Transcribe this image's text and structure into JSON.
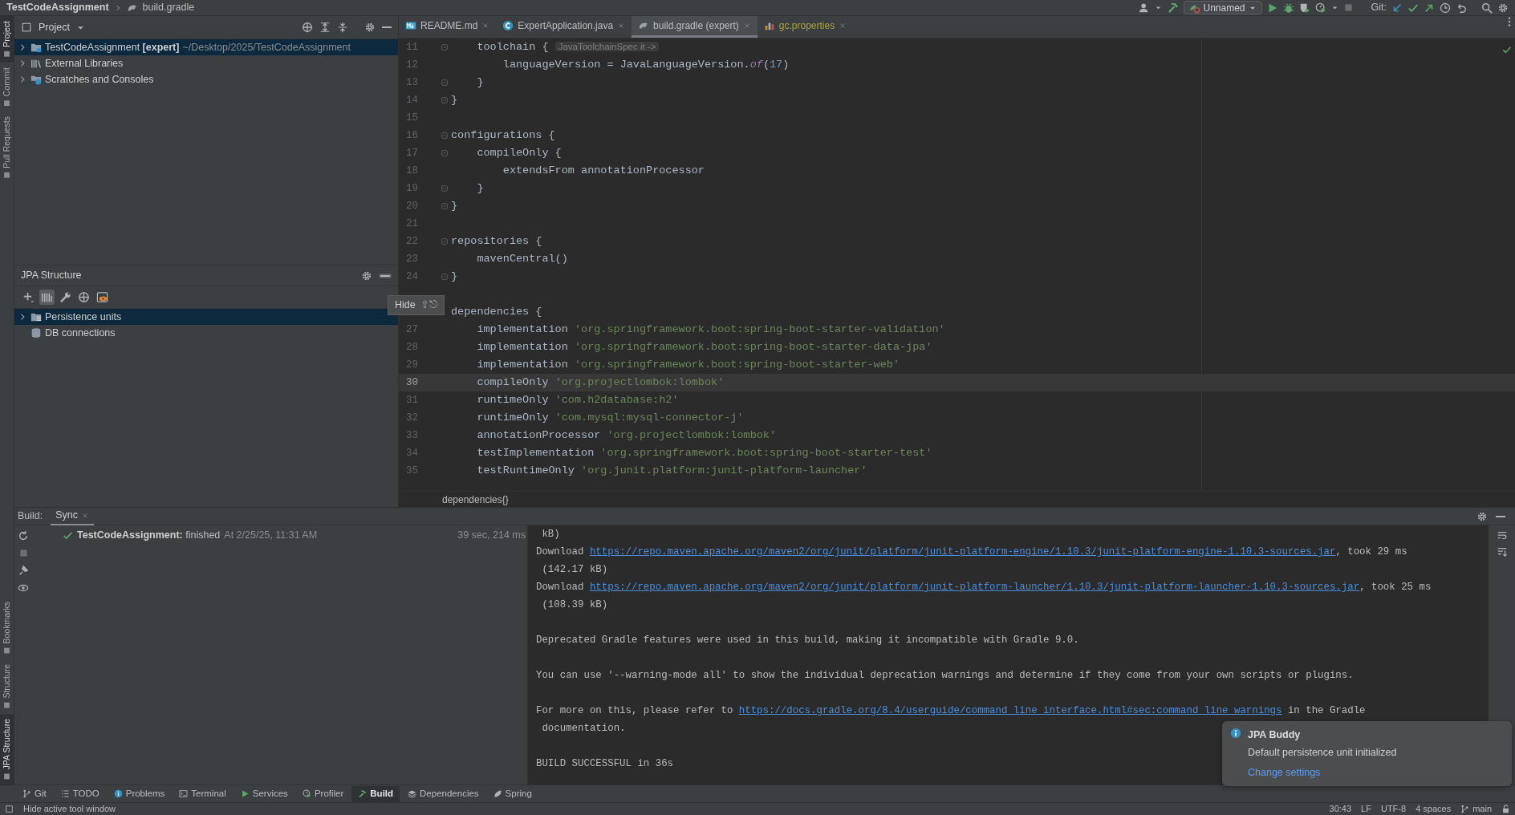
{
  "title_bar": {
    "project": "TestCodeAssignment",
    "file": "build.gradle",
    "run_config": "Unnamed",
    "git_label": "Git:"
  },
  "left_stripe": [
    {
      "label": "Project",
      "selected": true,
      "kind": "top"
    },
    {
      "label": "Commit",
      "selected": false,
      "kind": "top"
    },
    {
      "label": "Pull Requests",
      "selected": false,
      "kind": "top"
    },
    {
      "label": "Bookmarks",
      "selected": false,
      "kind": "bottom"
    },
    {
      "label": "Structure",
      "selected": false,
      "kind": "bottom"
    },
    {
      "label": "JPA Structure",
      "selected": true,
      "kind": "bottom"
    }
  ],
  "project_panel": {
    "title": "Project",
    "tree": [
      {
        "label": "TestCodeAssignment **[expert]**",
        "path": "~/Desktop/2025/TestCodeAssignment",
        "selected": true,
        "expanded": false
      },
      {
        "label": "External Libraries",
        "selected": false,
        "expanded": false
      },
      {
        "label": "Scratches and Consoles",
        "selected": false,
        "expanded": false
      }
    ]
  },
  "jpa_panel": {
    "title": "JPA Structure",
    "hide_button": {
      "hovered": true
    },
    "toolbar": [
      {
        "selected": false
      },
      {
        "selected": true
      },
      {
        "selected": false
      },
      {
        "selected": false
      },
      {
        "selected": false
      }
    ],
    "tree": [
      {
        "label": "Persistence units",
        "selected": true,
        "expandable": true
      },
      {
        "label": "DB connections",
        "selected": false,
        "expandable": false
      }
    ]
  },
  "tooltip": {
    "text": "Hide",
    "shortcut": "⇧⎋"
  },
  "editor": {
    "tabs": [
      {
        "label": "README.md",
        "selected": false,
        "color": "#bbbbbb"
      },
      {
        "label": "ExpertApplication.java",
        "selected": false,
        "color": "#bbbbbb"
      },
      {
        "label": "build.gradle (expert)",
        "selected": true,
        "color": "#bbbbbb"
      },
      {
        "label": "gc.properties",
        "selected": false,
        "color": "#a7a33c"
      }
    ],
    "lines": [
      {
        "number": "11",
        "fold": true,
        "current": false,
        "segments": [
          {
            "text": "    toolchain { ",
            "kind": "plain"
          },
          {
            "text": "JavaToolchainSpec it ->",
            "kind": "hint"
          }
        ]
      },
      {
        "number": "12",
        "fold": false,
        "current": false,
        "segments": [
          {
            "text": "        languageVersion = JavaLanguageVersion.",
            "kind": "plain"
          },
          {
            "text": "of",
            "kind": "italic"
          },
          {
            "text": "(",
            "kind": "plain"
          },
          {
            "text": "17",
            "kind": "number"
          },
          {
            "text": ")",
            "kind": "plain"
          }
        ]
      },
      {
        "number": "13",
        "fold": true,
        "current": false,
        "segments": [
          {
            "text": "    }",
            "kind": "plain"
          }
        ]
      },
      {
        "number": "14",
        "fold": true,
        "current": false,
        "segments": [
          {
            "text": "}",
            "kind": "plain"
          }
        ]
      },
      {
        "number": "15",
        "fold": false,
        "current": false
      },
      {
        "number": "16",
        "fold": true,
        "current": false,
        "segments": [
          {
            "text": "configurations {",
            "kind": "plain"
          }
        ]
      },
      {
        "number": "17",
        "fold": true,
        "current": false,
        "segments": [
          {
            "text": "    compileOnly {",
            "kind": "plain"
          }
        ]
      },
      {
        "number": "18",
        "fold": false,
        "current": false,
        "segments": [
          {
            "text": "        extendsFrom annotationProcessor",
            "kind": "plain"
          }
        ]
      },
      {
        "number": "19",
        "fold": true,
        "current": false,
        "segments": [
          {
            "text": "    }",
            "kind": "plain"
          }
        ]
      },
      {
        "number": "20",
        "fold": true,
        "current": false,
        "segments": [
          {
            "text": "}",
            "kind": "plain"
          }
        ]
      },
      {
        "number": "21",
        "fold": false,
        "current": false
      },
      {
        "number": "22",
        "fold": true,
        "current": false,
        "segments": [
          {
            "text": "repositories {",
            "kind": "plain"
          }
        ]
      },
      {
        "number": "23",
        "fold": false,
        "current": false,
        "segments": [
          {
            "text": "    mavenCentral()",
            "kind": "plain"
          }
        ]
      },
      {
        "number": "24",
        "fold": true,
        "current": false,
        "segments": [
          {
            "text": "}",
            "kind": "plain"
          }
        ]
      },
      {
        "fold": false,
        "current": false
      },
      {
        "fold": false,
        "current": false,
        "segments": [
          {
            "text": "dependencies {",
            "kind": "plain"
          }
        ]
      },
      {
        "number": "27",
        "fold": false,
        "current": false,
        "segments": [
          {
            "text": "    implementation ",
            "kind": "plain"
          },
          {
            "text": "'org.springframework.boot:spring-boot-starter-validation'",
            "kind": "string"
          }
        ]
      },
      {
        "number": "28",
        "fold": false,
        "current": false,
        "segments": [
          {
            "text": "    implementation ",
            "kind": "plain"
          },
          {
            "text": "'org.springframework.boot:spring-boot-starter-data-jpa'",
            "kind": "string"
          }
        ]
      },
      {
        "number": "29",
        "fold": false,
        "current": false,
        "segments": [
          {
            "text": "    implementation ",
            "kind": "plain"
          },
          {
            "text": "'org.springframework.boot:spring-boot-starter-web'",
            "kind": "string"
          }
        ]
      },
      {
        "number": "30",
        "fold": false,
        "current": true,
        "segments": [
          {
            "text": "    compileOnly ",
            "kind": "plain"
          },
          {
            "text": "'org.projectlombok:lombok'",
            "kind": "string"
          }
        ]
      },
      {
        "number": "31",
        "fold": false,
        "current": false,
        "segments": [
          {
            "text": "    runtimeOnly ",
            "kind": "plain"
          },
          {
            "text": "'com.h2database:h2'",
            "kind": "string"
          }
        ]
      },
      {
        "number": "32",
        "fold": false,
        "current": false,
        "segments": [
          {
            "text": "    runtimeOnly ",
            "kind": "plain"
          },
          {
            "text": "'com.mysql:mysql-connector-j'",
            "kind": "string"
          }
        ]
      },
      {
        "number": "33",
        "fold": false,
        "current": false,
        "segments": [
          {
            "text": "    annotationProcessor ",
            "kind": "plain"
          },
          {
            "text": "'org.projectlombok:lombok'",
            "kind": "string"
          }
        ]
      },
      {
        "number": "34",
        "fold": false,
        "current": false,
        "segments": [
          {
            "text": "    testImplementation ",
            "kind": "plain"
          },
          {
            "text": "'org.springframework.boot:spring-boot-starter-test'",
            "kind": "string"
          }
        ]
      },
      {
        "number": "35",
        "fold": false,
        "current": false,
        "segments": [
          {
            "text": "    testRuntimeOnly ",
            "kind": "plain"
          },
          {
            "text": "'org.junit.platform:junit-platform-launcher'",
            "kind": "string"
          }
        ]
      }
    ],
    "breadcrumb": "dependencies{}"
  },
  "build": {
    "label": "Build:",
    "tabs": [
      {
        "label": "Sync",
        "selected": true
      }
    ],
    "tree": [
      {
        "name": "TestCodeAssignment:",
        "status": "finished",
        "time": "At 2/25/25, 11:31 AM",
        "duration": "39 sec, 214 ms"
      }
    ],
    "console": [
      {
        "kind": "text",
        "segments": [
          {
            "text": " kB)",
            "kind": "text"
          }
        ]
      },
      {
        "kind": "text",
        "segments": [
          {
            "text": "Download ",
            "kind": "text"
          },
          {
            "text": "https://repo.maven.apache.org/maven2/org/junit/platform/junit-platform-engine/1.10.3/junit-platform-engine-1.10.3-sources.jar",
            "kind": "link"
          },
          {
            "text": ", took 29 ms",
            "kind": "text"
          }
        ]
      },
      {
        "kind": "text",
        "segments": [
          {
            "text": " (142.17 kB)",
            "kind": "text"
          }
        ]
      },
      {
        "kind": "text",
        "segments": [
          {
            "text": "Download ",
            "kind": "text"
          },
          {
            "text": "https://repo.maven.apache.org/maven2/org/junit/platform/junit-platform-launcher/1.10.3/junit-platform-launcher-1.10.3-sources.jar",
            "kind": "link"
          },
          {
            "text": ", took 25 ms",
            "kind": "text"
          }
        ]
      },
      {
        "kind": "text",
        "segments": [
          {
            "text": " (108.39 kB)",
            "kind": "text"
          }
        ]
      },
      {
        "kind": "blank"
      },
      {
        "kind": "text",
        "segments": [
          {
            "text": "Deprecated Gradle features were used in this build, making it incompatible with Gradle 9.0.",
            "kind": "text"
          }
        ]
      },
      {
        "kind": "blank"
      },
      {
        "kind": "text",
        "segments": [
          {
            "text": "You can use '--warning-mode all' to show the individual deprecation warnings and determine if they come from your own scripts or plugins.",
            "kind": "text"
          }
        ]
      },
      {
        "kind": "blank"
      },
      {
        "kind": "text",
        "segments": [
          {
            "text": "For more on this, please refer to ",
            "kind": "text"
          },
          {
            "text": "https://docs.gradle.org/8.4/userguide/command_line_interface.html#sec:command_line_warnings",
            "kind": "link"
          },
          {
            "text": " in the Gradle",
            "kind": "text"
          }
        ]
      },
      {
        "kind": "text",
        "segments": [
          {
            "text": " documentation.",
            "kind": "text"
          }
        ]
      },
      {
        "kind": "blank"
      },
      {
        "kind": "text",
        "segments": [
          {
            "text": "BUILD SUCCESSFUL in 36s",
            "kind": "text"
          }
        ]
      }
    ]
  },
  "notification": {
    "title": "JPA Buddy",
    "message": "Default persistence unit initialized",
    "action": "Change settings"
  },
  "tool_tabs": [
    {
      "label": "Git",
      "selected": false
    },
    {
      "label": "TODO",
      "selected": false
    },
    {
      "label": "Problems",
      "selected": false
    },
    {
      "label": "Terminal",
      "selected": false
    },
    {
      "label": "Services",
      "selected": false
    },
    {
      "label": "Profiler",
      "selected": false
    },
    {
      "label": "Build",
      "selected": true
    },
    {
      "label": "Dependencies",
      "selected": false
    },
    {
      "label": "Spring",
      "selected": false
    }
  ],
  "status_bar": {
    "hint": "Hide active tool window",
    "items": [
      "30:43",
      "LF",
      "UTF-8",
      "4 spaces"
    ],
    "branch": "main"
  }
}
